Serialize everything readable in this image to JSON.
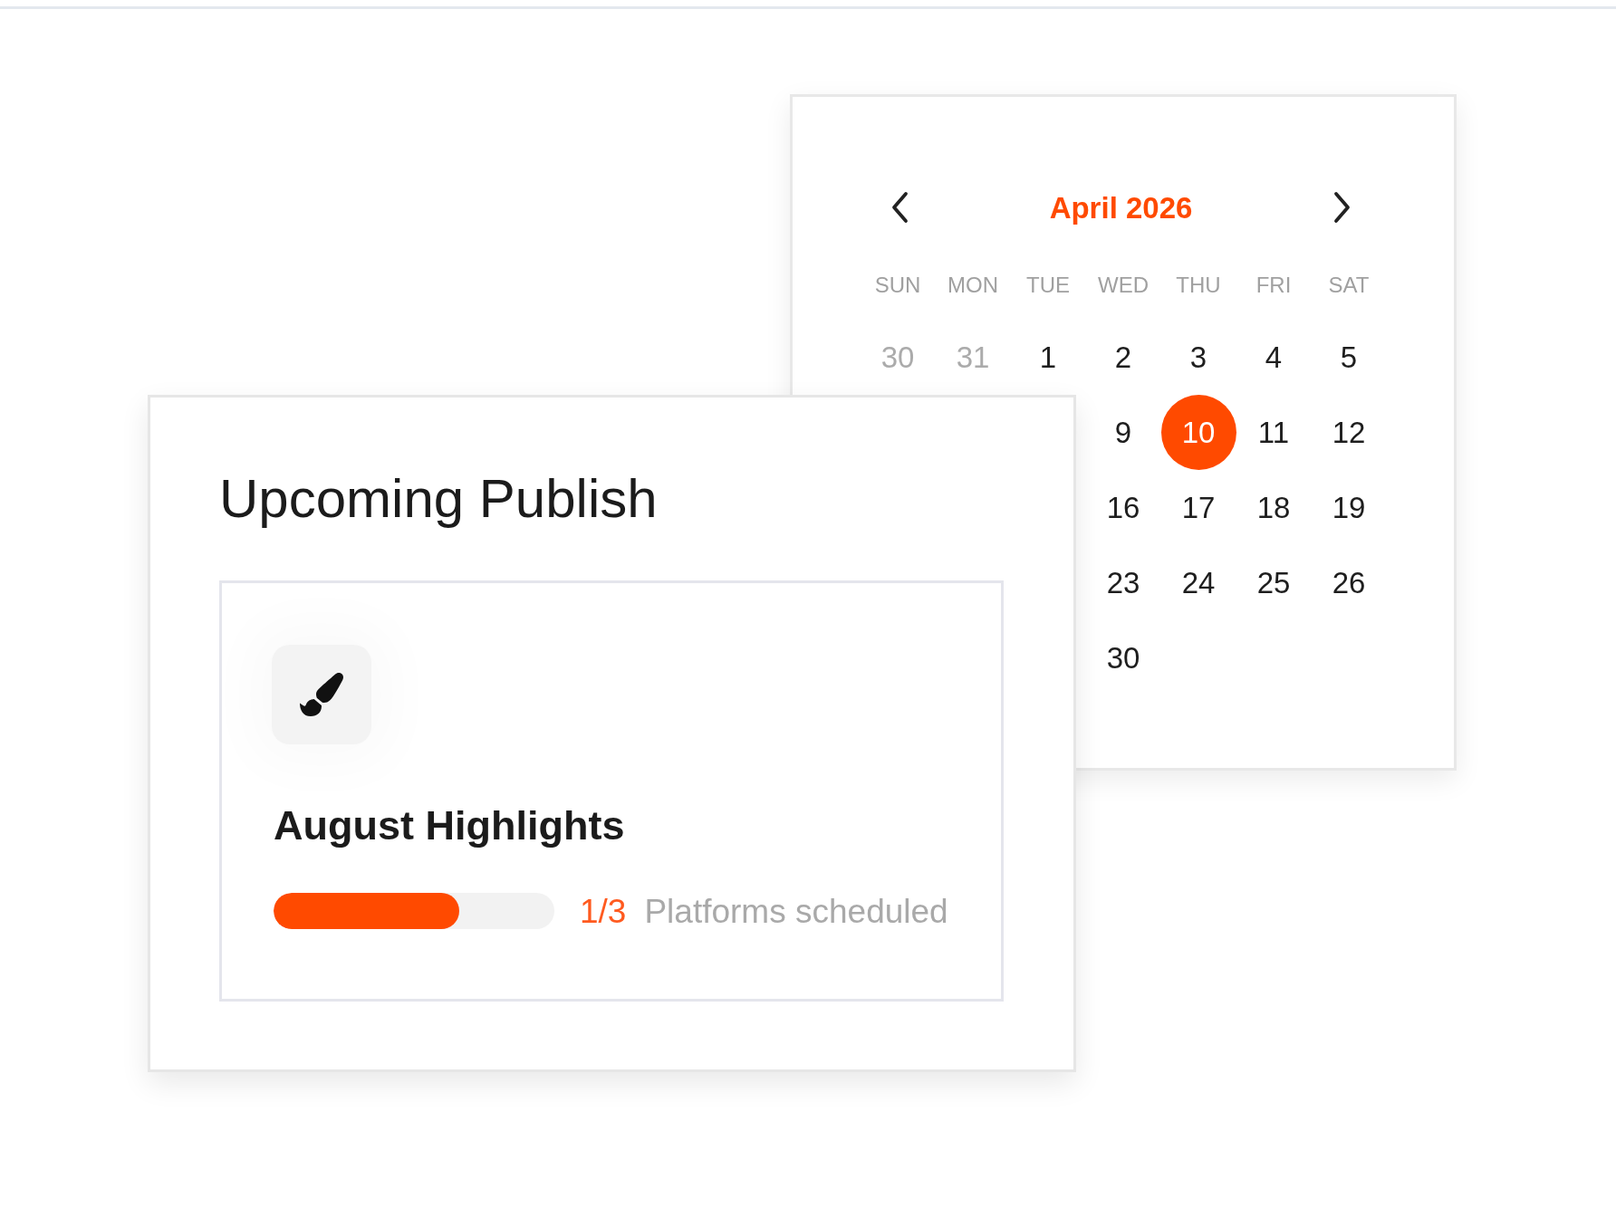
{
  "calendar": {
    "month_label": "April 2026",
    "columns": [
      {
        "weekday": "SUN",
        "days": [
          {
            "day": "30",
            "outside": true,
            "selected": false
          }
        ]
      },
      {
        "weekday": "MON",
        "days": [
          {
            "day": "31",
            "outside": true,
            "selected": false
          }
        ]
      },
      {
        "weekday": "TUE",
        "days": [
          {
            "day": "1",
            "outside": false,
            "selected": false
          }
        ]
      },
      {
        "weekday": "WED",
        "days": [
          {
            "day": "2",
            "outside": false,
            "selected": false
          },
          {
            "day": "9",
            "outside": false,
            "selected": false
          },
          {
            "day": "16",
            "outside": false,
            "selected": false
          },
          {
            "day": "23",
            "outside": false,
            "selected": false
          },
          {
            "day": "30",
            "outside": false,
            "selected": false
          }
        ]
      },
      {
        "weekday": "THU",
        "days": [
          {
            "day": "3",
            "outside": false,
            "selected": false
          },
          {
            "day": "10",
            "outside": false,
            "selected": true
          },
          {
            "day": "17",
            "outside": false,
            "selected": false
          },
          {
            "day": "24",
            "outside": false,
            "selected": false
          }
        ]
      },
      {
        "weekday": "FRI",
        "days": [
          {
            "day": "4",
            "outside": false,
            "selected": false
          },
          {
            "day": "11",
            "outside": false,
            "selected": false
          },
          {
            "day": "18",
            "outside": false,
            "selected": false
          },
          {
            "day": "25",
            "outside": false,
            "selected": false
          }
        ]
      },
      {
        "weekday": "SAT",
        "days": [
          {
            "day": "5",
            "outside": false,
            "selected": false
          },
          {
            "day": "12",
            "outside": false,
            "selected": false
          },
          {
            "day": "19",
            "outside": false,
            "selected": false
          },
          {
            "day": "26",
            "outside": false,
            "selected": false
          }
        ]
      }
    ]
  },
  "publish_card": {
    "title": "Upcoming Publish",
    "item": {
      "title": "August Highlights",
      "progress": {
        "level": 0.66,
        "count": "1/3",
        "label": "Platforms scheduled"
      }
    }
  }
}
